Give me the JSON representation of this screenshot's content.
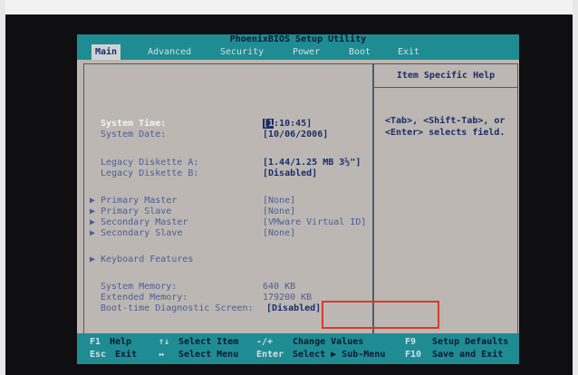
{
  "title": "PhoenixBIOS Setup Utility",
  "menu": [
    "Main",
    "Advanced",
    "Security",
    "Power",
    "Boot",
    "Exit"
  ],
  "help": {
    "title": "Item Specific Help",
    "line1": "<Tab>, <Shift-Tab>, or",
    "line2": "<Enter> selects field."
  },
  "settings": {
    "system_time_label": "System Time:",
    "system_time_cursor": "[1",
    "system_time_rest": ":10:45]",
    "system_date_label": "System Date:",
    "system_date_value": "[10/06/2006]",
    "diskette_a_label": "Legacy Diskette A:",
    "diskette_a_value": "[1.44/1.25 MB  3½\"]",
    "diskette_b_label": "Legacy Diskette B:",
    "diskette_b_value": "[Disabled]",
    "primary_master_label": "Primary Master",
    "primary_master_value": "[None]",
    "primary_slave_label": "Primary Slave",
    "primary_slave_value": "[None]",
    "secondary_master_label": "Secondary Master",
    "secondary_master_value": "[VMware Virtual ID]",
    "secondary_slave_label": "Secondary Slave",
    "secondary_slave_value": "[None]",
    "keyboard_label": "Keyboard Features",
    "system_memory_label": "System Memory:",
    "system_memory_value": "640 KB",
    "extended_memory_label": "Extended Memory:",
    "extended_memory_value": "179200 KB",
    "boot_diag_label": "Boot-time Diagnostic Screen:",
    "boot_diag_value": "[Disabled]",
    "submenu_arrow": "▶"
  },
  "footer": {
    "f1_key": "F1",
    "f1_desc": "Help",
    "updown_key": "↑↓",
    "updown_desc": "Select Item",
    "plusminus_key": "-/+",
    "plusminus_desc": "Change Values",
    "f9_key": "F9",
    "f9_desc": "Setup Defaults",
    "esc_key": "Esc",
    "esc_desc": "Exit",
    "leftright_key": "↔",
    "leftright_desc": "Select Menu",
    "enter_key": "Enter",
    "enter_desc": "Select ▶ Sub-Menu",
    "f10_key": "F10",
    "f10_desc": "Save and Exit"
  },
  "colors": {
    "bios_cyan": "#1f8c93",
    "panel_gray": "#bcb7b2",
    "text_navy": "#1a2d6a",
    "highlight_red": "#d83a2a"
  }
}
